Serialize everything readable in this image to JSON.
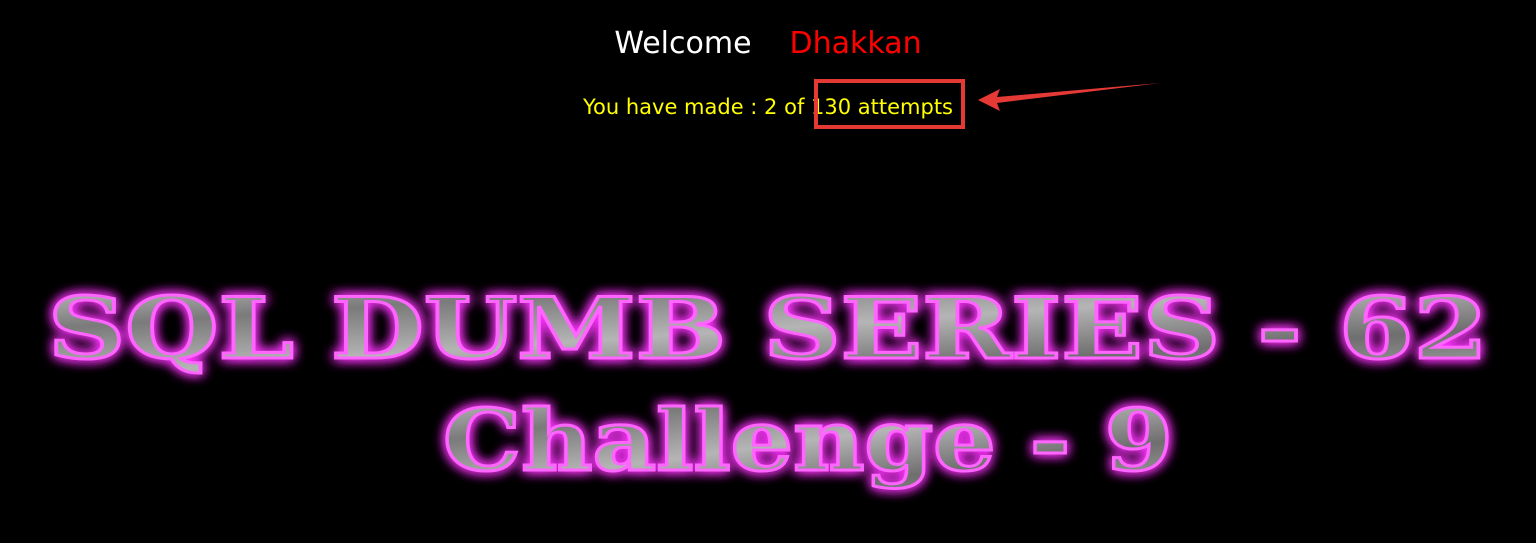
{
  "header": {
    "welcome_label": "Welcome",
    "user_name": "Dhakkan"
  },
  "status": {
    "attempts_prefix": "You have made : 2 of ",
    "attempts_suffix": "130 attempts"
  },
  "banner": {
    "line1": "SQL DUMB SERIES - 62",
    "line2": "Challenge - 9"
  },
  "colors": {
    "background": "#000000",
    "welcome": "#ffffff",
    "user_name": "#ff0000",
    "attempts": "#ffff00",
    "annotation": "#e53935",
    "banner_glow": "#ff33ff",
    "banner_fill": "#9a9a9a"
  }
}
